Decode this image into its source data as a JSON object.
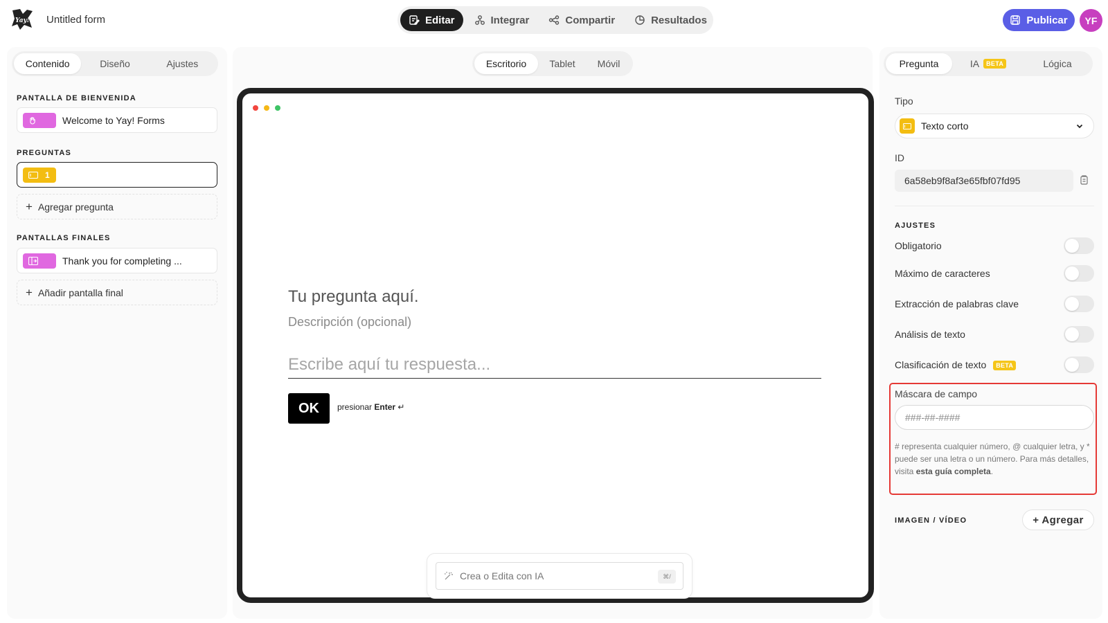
{
  "topbar": {
    "form_title": "Untitled form",
    "tabs": [
      {
        "label": "Editar",
        "icon": "edit-icon",
        "active": true
      },
      {
        "label": "Integrar",
        "icon": "integrate-icon",
        "active": false
      },
      {
        "label": "Compartir",
        "icon": "share-icon",
        "active": false
      },
      {
        "label": "Resultados",
        "icon": "results-icon",
        "active": false
      }
    ],
    "publish_label": "Publicar",
    "avatar_initials": "YF"
  },
  "left": {
    "tabs": [
      {
        "label": "Contenido",
        "active": true
      },
      {
        "label": "Diseño",
        "active": false
      },
      {
        "label": "Ajustes",
        "active": false
      }
    ],
    "welcome_heading": "PANTALLA DE BIENVENIDA",
    "welcome_item": "Welcome to Yay! Forms",
    "questions_heading": "PREGUNTAS",
    "question_number": "1",
    "add_question": "Agregar pregunta",
    "endings_heading": "PANTALLAS FINALES",
    "ending_item": "Thank you for completing ...",
    "add_ending": "Añadir pantalla final"
  },
  "center": {
    "device_tabs": [
      {
        "label": "Escritorio",
        "active": true
      },
      {
        "label": "Tablet",
        "active": false
      },
      {
        "label": "Móvil",
        "active": false
      }
    ],
    "question_title": "Tu pregunta aquí.",
    "question_desc": "Descripción (opcional)",
    "answer_placeholder": "Escribe aquí tu respuesta...",
    "ok_label": "OK",
    "enter_prefix": "presionar",
    "enter_key": "Enter",
    "enter_symbol": "↵",
    "ai_placeholder": "Crea o Edita con IA",
    "ai_shortcut": "⌘/"
  },
  "right": {
    "tabs": [
      {
        "label": "Pregunta",
        "active": true
      },
      {
        "label": "IA",
        "badge": "BETA",
        "active": false
      },
      {
        "label": "Lógica",
        "active": false
      }
    ],
    "type_label": "Tipo",
    "type_value": "Texto corto",
    "id_label": "ID",
    "id_value": "6a58eb9f8af3e65fbf07fd95",
    "settings_heading": "AJUSTES",
    "toggles": [
      {
        "label": "Obligatorio",
        "on": false
      },
      {
        "label": "Máximo de caracteres",
        "on": false
      },
      {
        "label": "Extracción de palabras clave",
        "on": false
      },
      {
        "label": "Análisis de texto",
        "on": false
      },
      {
        "label": "Clasificación de texto",
        "badge": "BETA",
        "on": false
      }
    ],
    "mask_label": "Máscara de campo",
    "mask_placeholder": "###-##-####",
    "mask_help_text": "# representa cualquier número, @ cualquier letra, y * puede ser una letra o un número. Para más detalles, visita",
    "mask_help_link": "esta guía completa",
    "mask_help_end": ".",
    "media_heading": "IMAGEN / VÍDEO",
    "media_add": "+ Agregar"
  },
  "colors": {
    "accent": "#5a5ee6",
    "avatar": "#c73fbf",
    "welcome_chip": "#e068e0",
    "question_chip": "#f3bd12",
    "highlight": "#e53935"
  }
}
